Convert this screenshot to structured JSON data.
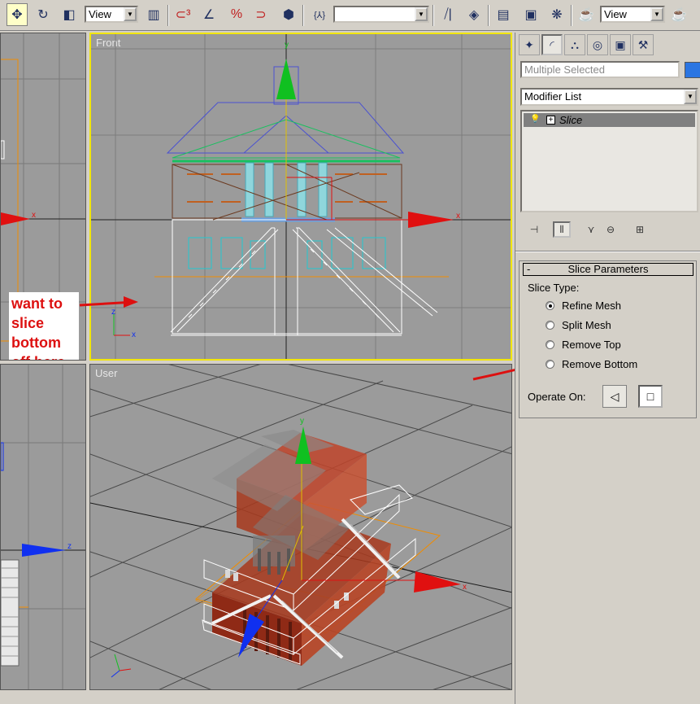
{
  "toolbar": {
    "reference_coord": "View",
    "named_selection": "",
    "pivot_coord": "View"
  },
  "viewports": {
    "top_left": {
      "label": ""
    },
    "front": {
      "label": "Front"
    },
    "bottom_left": {
      "label": ""
    },
    "user": {
      "label": "User"
    }
  },
  "gizmo_axes": {
    "x": "x",
    "y": "y",
    "z": "z"
  },
  "annotation": {
    "note": "want to\nslice\nbottom\noff here"
  },
  "command_panel": {
    "tabs": [
      "create-icon",
      "modify-icon",
      "hierarchy-icon",
      "motion-icon",
      "display-icon",
      "utilities-icon"
    ],
    "selection_name": "Multiple Selected",
    "object_color": "#2a75e2",
    "modifier_list": "Modifier List",
    "stack": {
      "items": [
        "Slice"
      ]
    }
  },
  "slice_parameters": {
    "title": "Slice Parameters",
    "collapse": "-",
    "slice_type_label": "Slice Type:",
    "options": [
      "Refine Mesh",
      "Split Mesh",
      "Remove Top",
      "Remove Bottom"
    ],
    "selected_index": 0,
    "operate_on_label": "Operate On:"
  },
  "colors": {
    "viewport_bg": "#9b9b9b",
    "active_border": "#f2e600",
    "annotation_red": "#dd1010",
    "axis_x": "#e01010",
    "axis_y": "#10c020",
    "axis_z": "#1030f0"
  }
}
